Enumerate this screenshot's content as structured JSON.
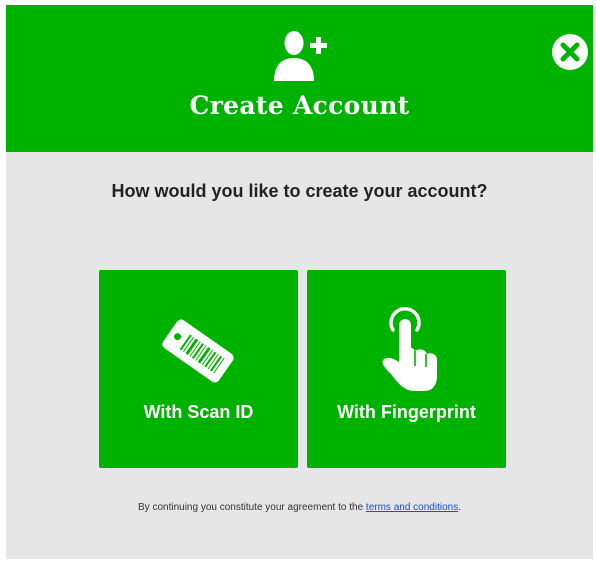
{
  "header": {
    "icon": "add-user-icon",
    "title": "Create Account",
    "close_icon": "close-icon"
  },
  "question": "How would you like to create your account?",
  "options": [
    {
      "icon": "barcode-card-icon",
      "label": "With Scan ID"
    },
    {
      "icon": "tap-finger-icon",
      "label": "With Fingerprint"
    }
  ],
  "footer": {
    "text": "By continuing you constitute your agreement to the ",
    "link": "terms and conditions",
    "end": "."
  },
  "colors": {
    "brand_green": "#00b200",
    "panel_bg": "#e6e6e6",
    "link_blue": "#1a4fd6"
  }
}
